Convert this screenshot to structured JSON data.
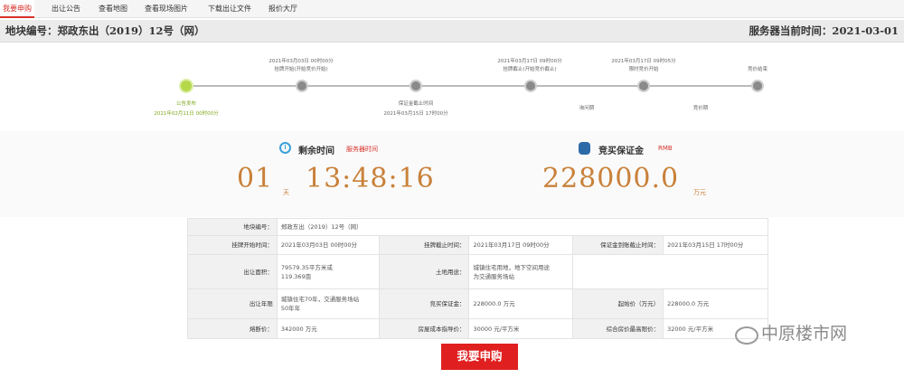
{
  "tabs": [
    "我要申购",
    "出让公告",
    "查看地图",
    "查看现场图片",
    "下载出让文件",
    "报价大厅"
  ],
  "header": {
    "title": "地块编号：郑政东出（2019）12号（网）",
    "server_time": "服务器当前时间：2021-03-01"
  },
  "timeline": {
    "upper_labels": [
      {
        "time": "2021年03月03日 00时00分",
        "desc": "挂牌开始(开始竞价开始)"
      },
      {
        "time": "2021年03月17日 09时00分",
        "desc": "挂牌截止(开始竞价截止)"
      },
      {
        "time": "2021年03月17日 09时05分",
        "desc": "限时竞价开始"
      },
      {
        "time": "",
        "desc": "竞价结束"
      }
    ],
    "lower_labels": [
      {
        "desc": "公告发布",
        "time": "2021年02月11日 00时00分"
      },
      {
        "desc": "保证金截止时间",
        "time": "2021年03月15日 17时00分"
      },
      {
        "desc": "询问期",
        "time": ""
      },
      {
        "desc": "竞价期",
        "time": ""
      }
    ]
  },
  "countdown": {
    "label": "剩余时间",
    "note": "服务器时间",
    "days": "01",
    "day_unit": "天",
    "time": "13:48:16"
  },
  "deposit": {
    "label": "竞买保证金",
    "note": "RMB",
    "amount": "228000.0",
    "unit": "万元"
  },
  "info": {
    "parcel_label": "地块编号：",
    "parcel_value": "郑政东出（2019）12号（网）",
    "listing_start_label": "挂牌开始时间：",
    "listing_start_value": "2021年03月03日 00时00分",
    "listing_end_label": "挂牌截止时间：",
    "listing_end_value": "2021年03月17日 09时00分",
    "deposit_deadline_label": "保证金到账截止时间：",
    "deposit_deadline_value": "2021年03月15日 17时00分",
    "area_label": "出让面积：",
    "area_value_1": "79579.35平方米或",
    "area_value_2": "119.369亩",
    "use_label": "土地用途：",
    "use_value_1": "城镇住宅用地，地下空间用途",
    "use_value_2": "为交通服务场站",
    "term_label": "出让年限",
    "term_value_1": "城镇住宅70年，交通服务场站",
    "term_value_2": "50年年",
    "bid_deposit_label": "竞买保证金：",
    "bid_deposit_value": "228000.0 万元",
    "start_price_label": "起始价（万元）",
    "start_price_value": "228000.0 万元",
    "cap_price_label": "熔断价：",
    "cap_price_value": "342000 万元",
    "cost_label": "房屋成本指导价：",
    "cost_value": "30000 元/平方米",
    "max_price_label": "综合房价最高限价：",
    "max_price_value": "32000 元/平方米"
  },
  "apply_button": "我要申购",
  "watermark": "中原楼市网"
}
